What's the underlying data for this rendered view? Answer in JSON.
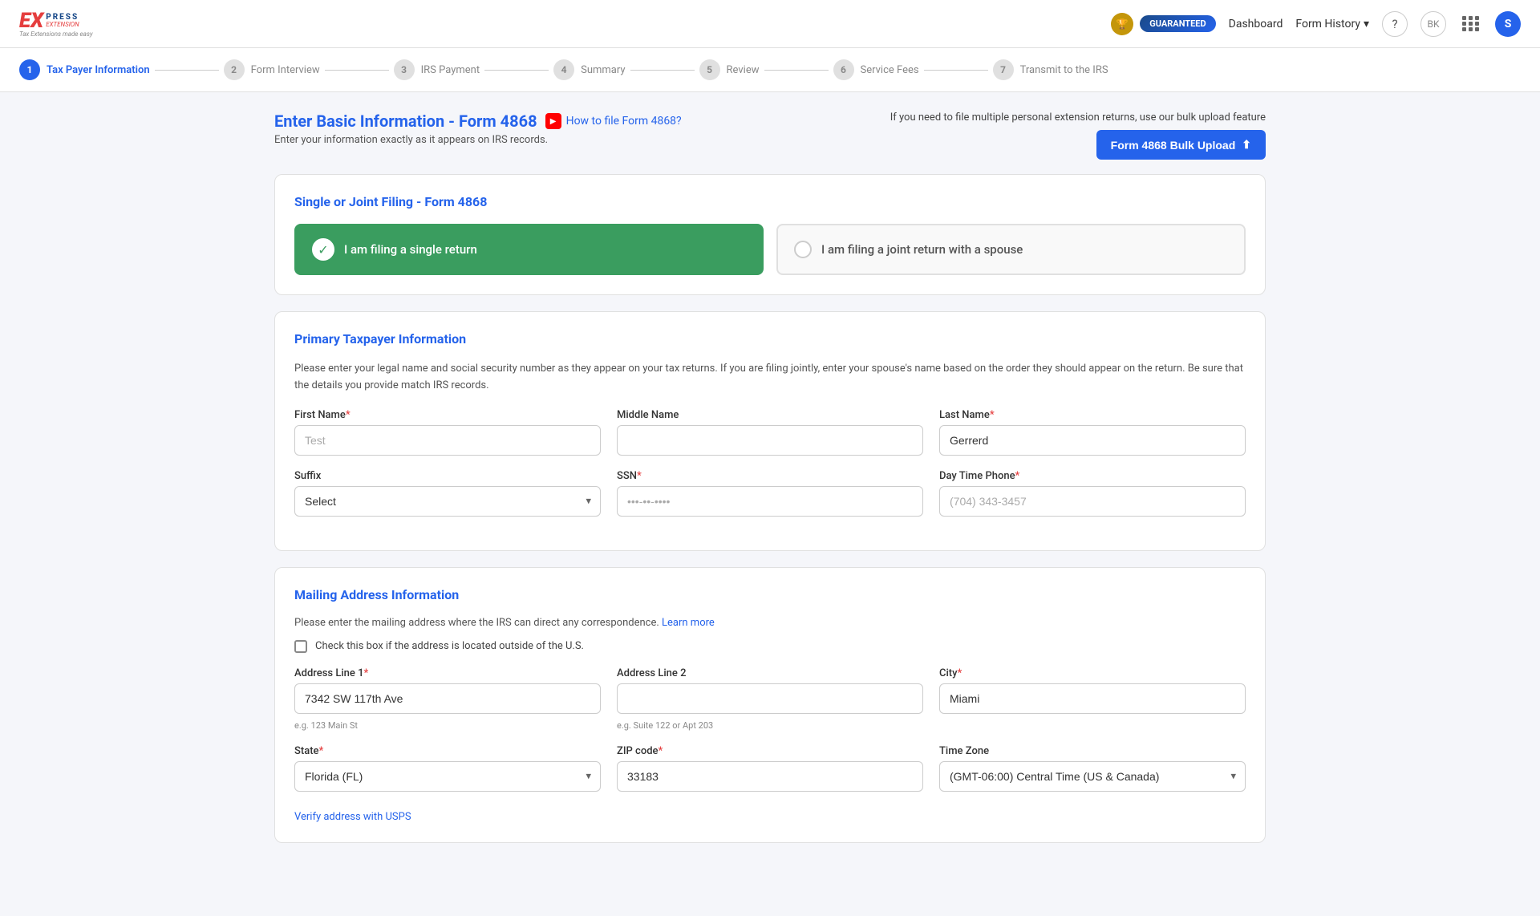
{
  "header": {
    "logo": {
      "express": "EX",
      "press": "PRESS",
      "tagline": "Tax Extensions made easy"
    },
    "guaranteed_badge": "GUARANTEED",
    "dashboard_link": "Dashboard",
    "form_history_link": "Form History",
    "avatar_initial": "S"
  },
  "steps": [
    {
      "number": "1",
      "label": "Tax Payer Information",
      "state": "active"
    },
    {
      "number": "2",
      "label": "Form Interview",
      "state": "inactive"
    },
    {
      "number": "3",
      "label": "IRS Payment",
      "state": "inactive"
    },
    {
      "number": "4",
      "label": "Summary",
      "state": "inactive"
    },
    {
      "number": "5",
      "label": "Review",
      "state": "inactive"
    },
    {
      "number": "6",
      "label": "Service Fees",
      "state": "inactive"
    },
    {
      "number": "7",
      "label": "Transmit to the IRS",
      "state": "inactive"
    }
  ],
  "page": {
    "title": "Enter Basic Information - Form 4868",
    "how_to_link": "How to file Form 4868?",
    "subtitle": "Enter your information exactly as it appears on IRS records.",
    "bulk_info": "If you need to file multiple personal extension returns, use our bulk upload feature",
    "bulk_btn": "Form 4868 Bulk Upload"
  },
  "filing_section": {
    "title": "Single or Joint Filing - Form 4868",
    "option_single": "I am filing a single return",
    "option_joint": "I am filing a joint return with a spouse"
  },
  "taxpayer_section": {
    "title": "Primary Taxpayer Information",
    "description": "Please enter your legal name and social security number as they appear on your tax returns. If you are filing jointly, enter your spouse's name based on the order they should appear on the return. Be sure that the details you provide match IRS records.",
    "first_name_label": "First Name",
    "first_name_value": "Test",
    "first_name_placeholder": "",
    "middle_name_label": "Middle Name",
    "middle_name_value": "",
    "last_name_label": "Last Name",
    "last_name_value": "Gerrerd",
    "suffix_label": "Suffix",
    "suffix_value": "Select",
    "ssn_label": "SSN",
    "ssn_value": "•••-••-••••",
    "ssn_placeholder": "•••-••-••••",
    "day_phone_label": "Day Time Phone",
    "day_phone_value": "(704) 343-3457"
  },
  "mailing_section": {
    "title": "Mailing Address Information",
    "description": "Please enter the mailing address where the IRS can direct any correspondence.",
    "learn_more": "Learn more",
    "outside_us_label": "Check this box if the address is located outside of the U.S.",
    "address1_label": "Address Line 1",
    "address1_value": "7342 SW 117th Ave",
    "address1_hint": "e.g. 123 Main St",
    "address2_label": "Address Line 2",
    "address2_value": "",
    "address2_hint": "e.g. Suite 122 or Apt 203",
    "city_label": "City",
    "city_value": "Miami",
    "state_label": "State",
    "state_value": "Florida (FL)",
    "zip_label": "ZIP code",
    "zip_value": "33183",
    "timezone_label": "Time Zone",
    "timezone_value": "(GMT-06:00) Central Time (US & Canada)",
    "usps_link": "Verify address with USPS"
  }
}
